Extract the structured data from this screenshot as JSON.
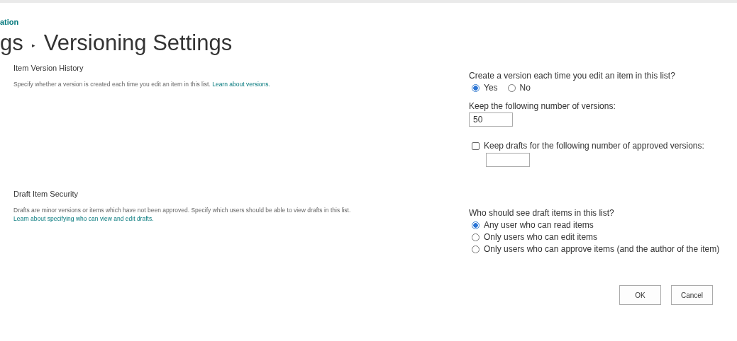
{
  "breadcrumb": {
    "parent": "ation"
  },
  "page_title": {
    "previous": "gs",
    "separator": "▸",
    "current": "Versioning Settings"
  },
  "sections": [
    {
      "heading": "Item Version History",
      "description": "Specify whether a version is created each time you edit an item in this list.",
      "link": "Learn about versions.",
      "controls": [
        {
          "kind": "radio_group",
          "question": "Create a version each time you edit an item in this list?",
          "inline": true,
          "options": [
            {
              "label": "Yes",
              "selected": true
            },
            {
              "label": "No",
              "selected": false
            }
          ]
        },
        {
          "kind": "number_field",
          "label": "Keep the following number of versions:",
          "value": "50"
        },
        {
          "kind": "checkbox_field",
          "label": "Keep drafts for the following number of approved versions:",
          "checked": false
        }
      ]
    },
    {
      "heading": "Draft Item Security",
      "description": "Drafts are minor versions or items which have not been approved. Specify which users should be able to view drafts in this list.",
      "link": "Learn about specifying who can view and edit drafts.",
      "controls": [
        {
          "kind": "radio_group",
          "question": "Who should see draft items in this list?",
          "inline": false,
          "options": [
            {
              "label": "Any user who can read items",
              "selected": true
            },
            {
              "label": "Only users who can edit items",
              "selected": false
            },
            {
              "label": "Only users who can approve items (and the author of the item)",
              "selected": false
            }
          ]
        }
      ]
    }
  ],
  "buttons": [
    "OK",
    "Cancel"
  ]
}
